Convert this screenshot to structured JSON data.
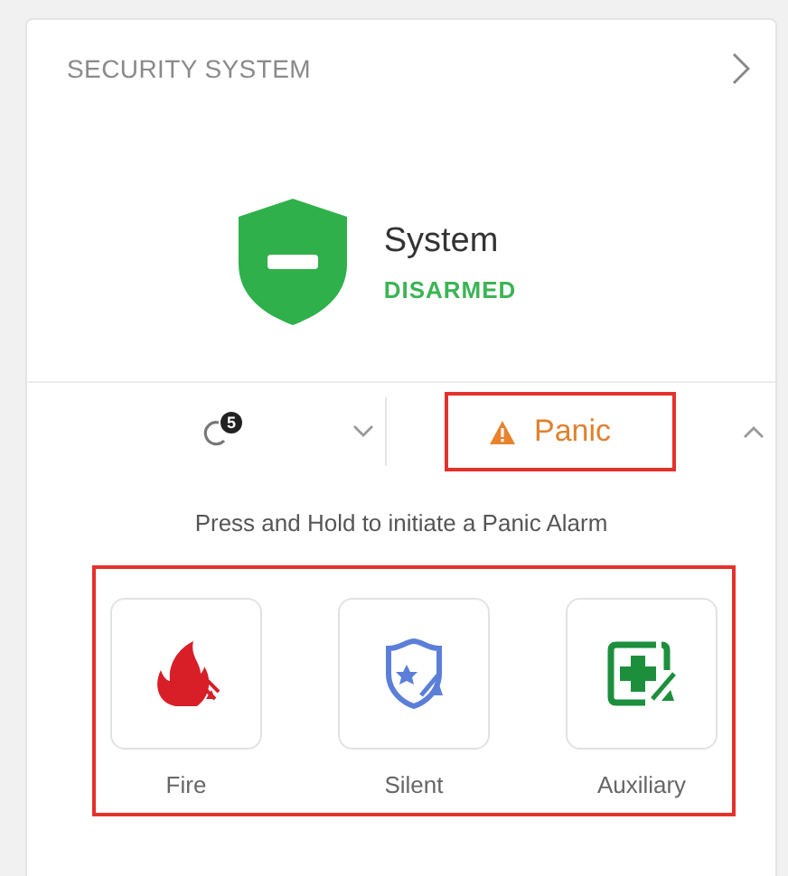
{
  "card": {
    "title": "SECURITY SYSTEM"
  },
  "status": {
    "label": "System",
    "state": "DISARMED",
    "armed": false
  },
  "tabs": [
    {
      "kind": "badge",
      "badge": "5",
      "selected": false
    },
    {
      "kind": "panic",
      "label": "Panic",
      "selected": true,
      "highlighted": true
    }
  ],
  "panic_panel": {
    "instruction": "Press and Hold to initiate a Panic Alarm",
    "highlighted": true,
    "buttons": [
      {
        "kind": "fire",
        "label": "Fire"
      },
      {
        "kind": "silent",
        "label": "Silent"
      },
      {
        "kind": "auxiliary",
        "label": "Auxiliary"
      }
    ]
  }
}
